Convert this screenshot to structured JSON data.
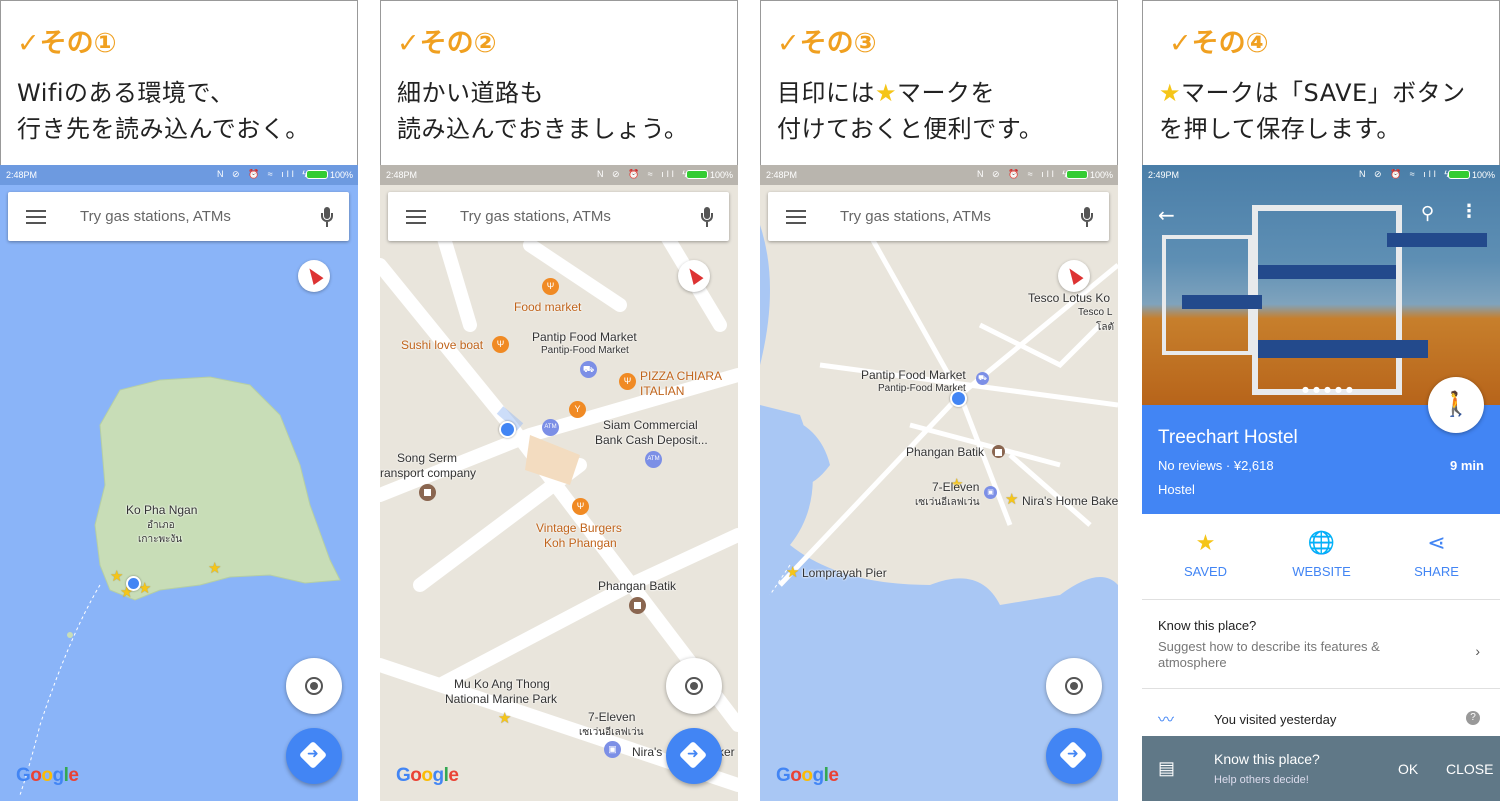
{
  "panels": [
    {
      "step": "✓その①",
      "line1": "Wifiのある環境で、",
      "line2": "行き先を読み込んでおく。"
    },
    {
      "step": "✓その②",
      "line1": "細かい道路も",
      "line2": "読み込んでおきましょう。"
    },
    {
      "step": "✓その③",
      "line1a": "目印には",
      "line1b": "★",
      "line1c": "マークを",
      "line2": "付けておくと便利です。"
    },
    {
      "step": "✓その④",
      "line1a": "★",
      "line1b": "マークは「SAVE」ボタン",
      "line2": "を押して保存します。"
    }
  ],
  "status": {
    "time123": "2:48PM",
    "time4": "2:49PM",
    "icons": "N ⊘ ⏰ ≈ ıll ϟ",
    "battery": "100%"
  },
  "search": {
    "placeholder": "Try gas stations, ATMs"
  },
  "google": {
    "g1": "G",
    "o1": "o",
    "o2": "o",
    "g2": "g",
    "l": "l",
    "e": "e"
  },
  "map1": {
    "island": "Ko Pha Ngan",
    "island_th1": "อำเภอ",
    "island_th2": "เกาะพะงัน"
  },
  "map2": {
    "food_market": "Food market",
    "sushi": "Sushi love boat",
    "pantip": "Pantip Food Market",
    "pantip_sub": "Pantip-Food Market",
    "pizza1": "PIZZA CHIARA",
    "pizza2": "ITALIAN",
    "siam1": "Siam Commercial",
    "siam2": "Bank Cash Deposit...",
    "song1": "Song Serm",
    "song2": "ransport company",
    "vintage1": "Vintage Burgers",
    "vintage2": "Koh Phangan",
    "batik": "Phangan Batik",
    "mu1": "Mu Ko Ang Thong",
    "mu2": "National Marine Park",
    "seven": "7-Eleven",
    "seven_th": "เซเว่นอีเลฟเว่น",
    "niras": "Nira's",
    "baker": "ker",
    "atm": "ATM"
  },
  "map3": {
    "tesco1": "Tesco Lotus Ko",
    "tesco2": "Tesco L",
    "tesco3": "โลตั",
    "pantip": "Pantip Food Market",
    "pantip_sub": "Pantip-Food Market",
    "batik": "Phangan Batik",
    "seven": "7-Eleven",
    "seven_th": "เซเว่นอีเลฟเว่น",
    "niras": "Nira's Home Bake",
    "pier": "Lomprayah Pier"
  },
  "place": {
    "name": "Treechart Hostel",
    "reviews": "No reviews · ¥2,618",
    "type": "Hostel",
    "time": "9 min",
    "actions": [
      {
        "icon": "★",
        "label": "SAVED"
      },
      {
        "icon": "🌐",
        "label": "WEBSITE"
      },
      {
        "icon": "⋖",
        "label": "SHARE"
      }
    ],
    "know_title": "Know this place?",
    "know_sub": "Suggest how to describe its features & atmosphere",
    "visited": "You visited yesterday",
    "snack_title": "Know this place?",
    "snack_sub": "Help others decide!",
    "ok": "OK",
    "close": "CLOSE"
  },
  "colors": {
    "accent": "#4285f4",
    "step": "#f0a020",
    "star": "#f5c518",
    "sea": "#8ab4f8",
    "land": "#e8e6df"
  }
}
